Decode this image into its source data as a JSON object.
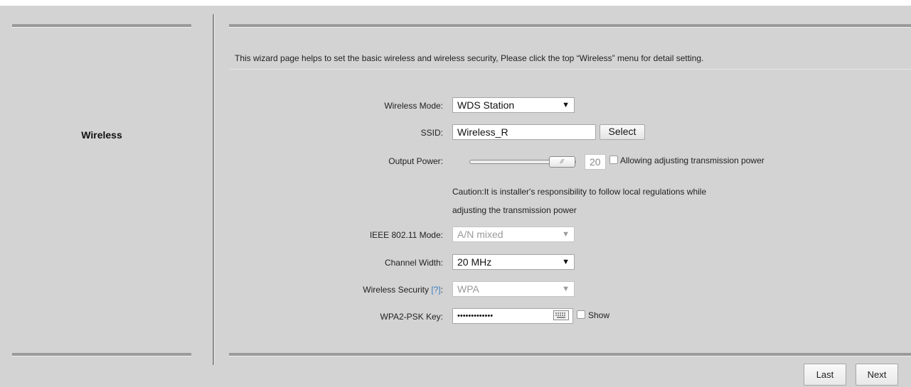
{
  "sidebar": {
    "title": "Wireless"
  },
  "intro": "This wizard page helps to set the basic wireless and wireless security, Please click the top “Wireless” menu for detail setting.",
  "form": {
    "wireless_mode": {
      "label": "Wireless Mode:",
      "value": "WDS Station"
    },
    "ssid": {
      "label": "SSID:",
      "value": "Wireless_R",
      "select_label": "Select"
    },
    "output_power": {
      "label": "Output Power:",
      "value": "20",
      "level": 1.0,
      "allow_label": "Allowing adjusting transmission power",
      "caution_line1": "Caution:It is installer's responsibility to follow local regulations while",
      "caution_line2": "adjusting the transmission power"
    },
    "ieee_mode": {
      "label": "IEEE 802.11 Mode:",
      "value": "A/N mixed"
    },
    "channel_width": {
      "label": "Channel Width:",
      "value": "20 MHz"
    },
    "wireless_security": {
      "label": "Wireless Security",
      "help": "[?]",
      "colon": ":",
      "value": "WPA"
    },
    "psk_key": {
      "label": "WPA2-PSK Key:",
      "value": "•••••••••••••",
      "show_label": "Show"
    }
  },
  "nav": {
    "last_label": "Last",
    "next_label": "Next"
  },
  "colors": {
    "accent": "#3b7fc4",
    "background": "#d3d3d3"
  }
}
